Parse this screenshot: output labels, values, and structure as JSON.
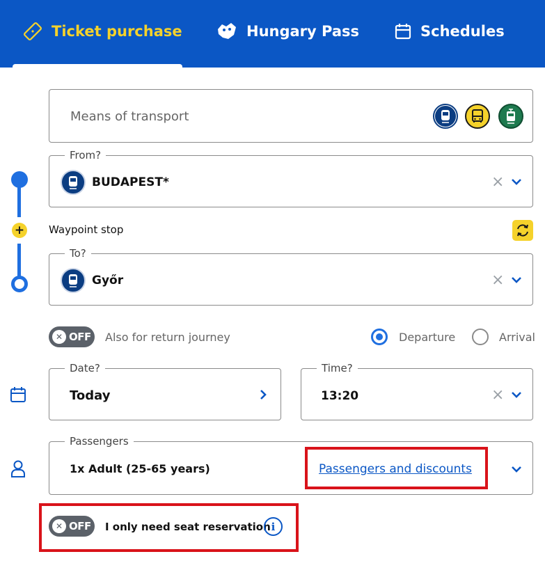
{
  "header": {
    "tabs": [
      {
        "label": "Ticket purchase",
        "icon": "ticket-icon",
        "active": true
      },
      {
        "label": "Hungary Pass",
        "icon": "hungary-pass-icon",
        "active": false
      },
      {
        "label": "Schedules",
        "icon": "calendar-icon",
        "active": false
      }
    ]
  },
  "transport": {
    "placeholder": "Means of transport",
    "modes": [
      "train-icon",
      "bus-icon",
      "tram-icon"
    ]
  },
  "from": {
    "legend": "From?",
    "value": "BUDAPEST*",
    "icon": "train-icon"
  },
  "waypoint": {
    "label": "Waypoint stop"
  },
  "to": {
    "legend": "To?",
    "value": "Győr",
    "icon": "train-icon"
  },
  "return_toggle": {
    "state": "OFF",
    "label": "Also for return journey"
  },
  "time_mode": {
    "departure": "Departure",
    "arrival": "Arrival",
    "selected": "Departure"
  },
  "date": {
    "legend": "Date?",
    "value": "Today"
  },
  "time": {
    "legend": "Time?",
    "value": "13:20"
  },
  "passengers": {
    "legend": "Passengers",
    "value": "1x Adult (25-65 years)",
    "link": "Passengers and discounts"
  },
  "seat_toggle": {
    "state": "OFF",
    "label": "I only need seat reservation"
  },
  "colors": {
    "brand_blue": "#0b57c5",
    "accent_yellow": "#f5d22b",
    "highlight_red": "#d9131a",
    "tram_green": "#1e7a4f"
  }
}
